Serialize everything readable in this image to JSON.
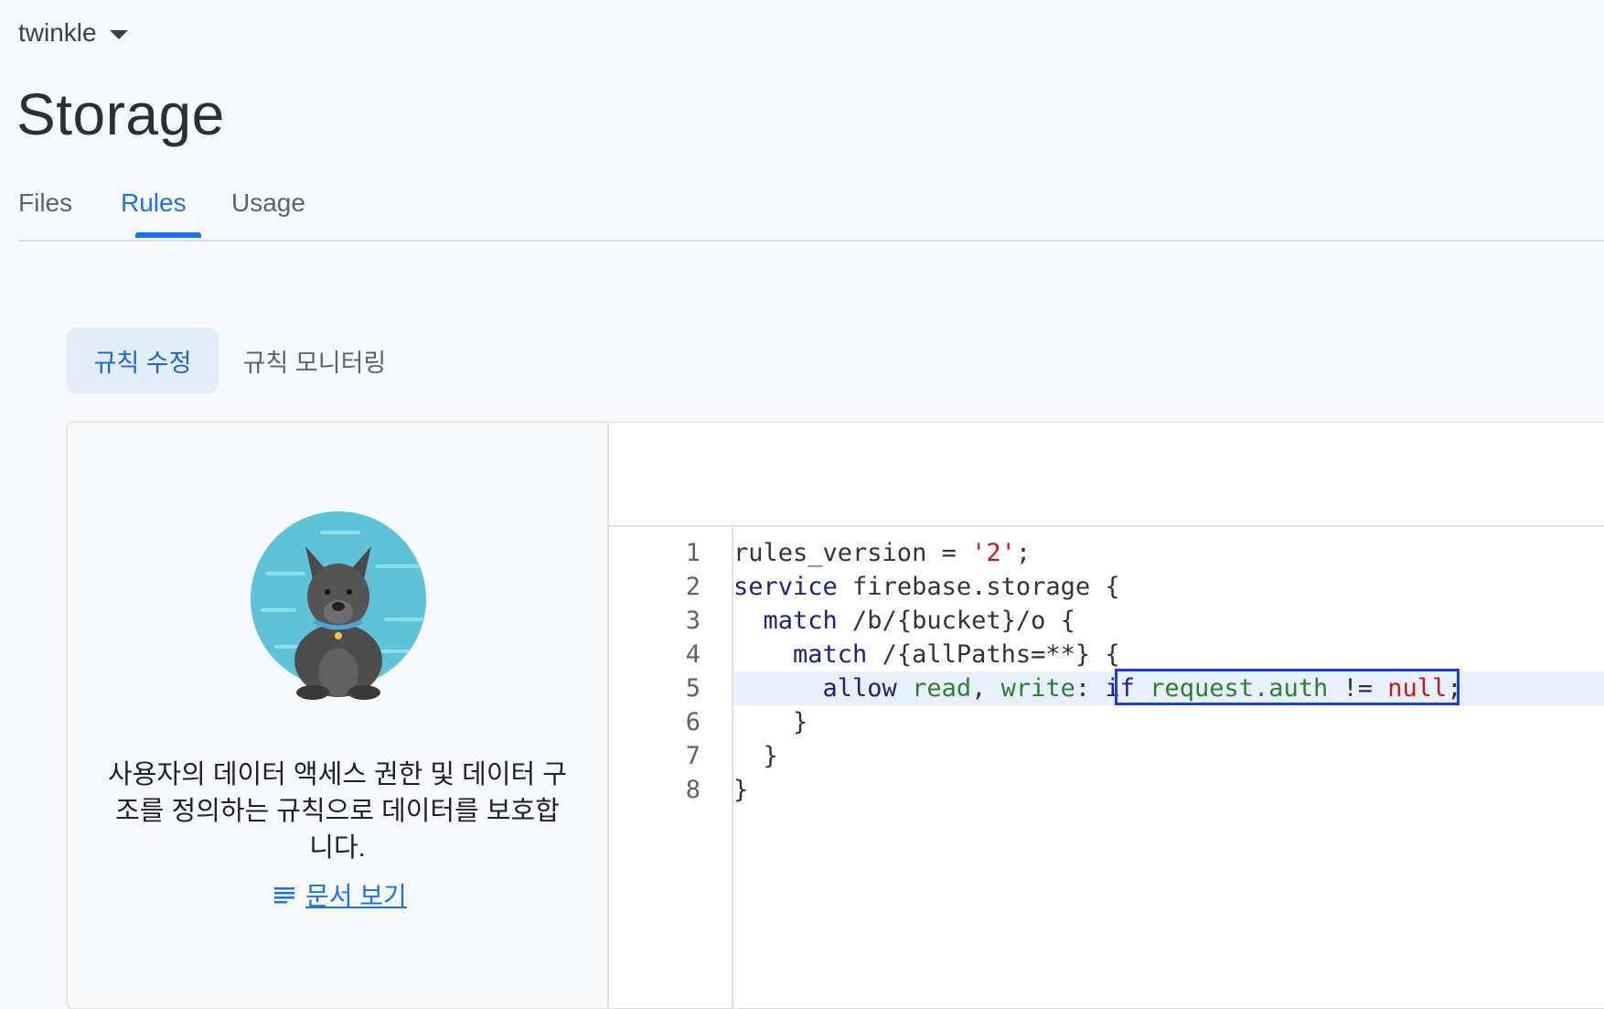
{
  "project": {
    "name": "twinkle"
  },
  "page": {
    "title": "Storage"
  },
  "tabs": [
    {
      "label": "Files"
    },
    {
      "label": "Rules"
    },
    {
      "label": "Usage"
    }
  ],
  "subtabs": [
    {
      "label": "규칙 수정"
    },
    {
      "label": "규칙 모니터링"
    }
  ],
  "left_panel": {
    "description": "사용자의 데이터 액세스 권한 및 데이터 구조를 정의하는 규칙으로 데이터를 보호합니다.",
    "docs_link": "문서 보기",
    "docs_icon": "notes-icon",
    "illustration": "dog-mascot"
  },
  "editor": {
    "line_numbers": [
      "1",
      "2",
      "3",
      "4",
      "5",
      "6",
      "7",
      "8"
    ],
    "lines": {
      "l1a": "rules_version = ",
      "l1b": "'2'",
      "l1c": ";",
      "l2a": "service",
      "l2b": " firebase.storage {",
      "l3a": "  match",
      "l3b": " /b/{bucket}/o {",
      "l4a": "    match",
      "l4b": " /{allPaths=**} {",
      "l5a": "      allow",
      "l5b": " read",
      "l5c": ", ",
      "l5d": "write",
      "l5e": ": ",
      "l5f": "if",
      "l5g": " request.auth",
      "l5h": " != ",
      "l5i": "null",
      "l5j": ";",
      "l6": "    }",
      "l7": "  }",
      "l8": "}"
    },
    "highlighted_line": 5
  },
  "colors": {
    "accent": "#1a73e8",
    "selection_box": "#1a3ee0"
  }
}
